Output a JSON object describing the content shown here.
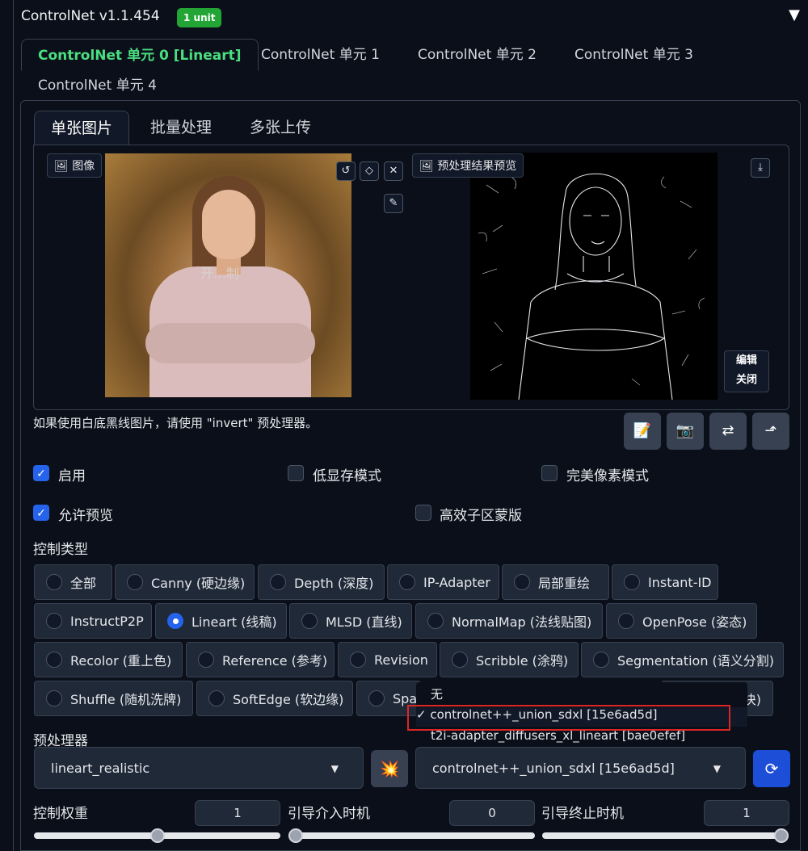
{
  "header": {
    "title": "ControlNet v1.1.454",
    "badge": "1 unit",
    "collapse_icon": "triangle-down-icon"
  },
  "unit_tabs": [
    {
      "label": "ControlNet 单元 0 [Lineart]",
      "active": true
    },
    {
      "label": "ControlNet 单元 1",
      "active": false
    },
    {
      "label": "ControlNet 单元 2",
      "active": false
    },
    {
      "label": "ControlNet 单元 3",
      "active": false
    },
    {
      "label": "ControlNet 单元 4",
      "active": false
    }
  ],
  "image_tabs": [
    {
      "label": "单张图片",
      "active": true
    },
    {
      "label": "批量处理",
      "active": false
    },
    {
      "label": "多张上传",
      "active": false
    }
  ],
  "image_panel": {
    "input_label": "图像",
    "preview_label": "预处理结果预览",
    "watermark": "开…制",
    "edit_label": "编辑",
    "close_label": "关闭"
  },
  "hint": "如果使用白底黑线图片，请使用 \"invert\" 预处理器。",
  "options": {
    "enable": "启用",
    "low_vram": "低显存模式",
    "pixel_perfect": "完美像素模式",
    "allow_preview": "允许预览",
    "efficient_mask": "高效子区蒙版"
  },
  "control_type": {
    "label": "控制类型",
    "items": [
      "全部",
      "Canny (硬边缘)",
      "Depth (深度)",
      "IP-Adapter",
      "局部重绘",
      "Instant-ID",
      "InstructP2P",
      "Lineart (线稿)",
      "MLSD (直线)",
      "NormalMap (法线贴图)",
      "OpenPose (姿态)",
      "Recolor (重上色)",
      "Reference (参考)",
      "Revision",
      "Scribble (涂鸦)",
      "Segmentation (语义分割)",
      "Shuffle (随机洗牌)",
      "SoftEdge (软边缘)",
      "Spa",
      "块)"
    ],
    "selected": "Lineart (线稿)"
  },
  "model_dropdown": {
    "items": [
      "无",
      "✓ controlnet++_union_sdxl [15e6ad5d]",
      "t2i-adapter_diffusers_xl_lineart [bae0efef]"
    ]
  },
  "preprocessor": {
    "label": "预处理器",
    "value": "lineart_realistic",
    "model_value": "controlnet++_union_sdxl [15e6ad5d]"
  },
  "sliders": {
    "weight_label": "控制权重",
    "weight_value": "1",
    "weight_fraction": 0.5,
    "start_label": "引导介入时机",
    "start_value": "0",
    "start_fraction": 0.0,
    "end_label": "引导终止时机",
    "end_value": "1",
    "end_fraction": 1.0
  },
  "colors": {
    "accent_green": "#4ade80",
    "badge_green": "#22a534",
    "checkbox_blue": "#2563eb",
    "highlight_red": "#dc2626"
  }
}
